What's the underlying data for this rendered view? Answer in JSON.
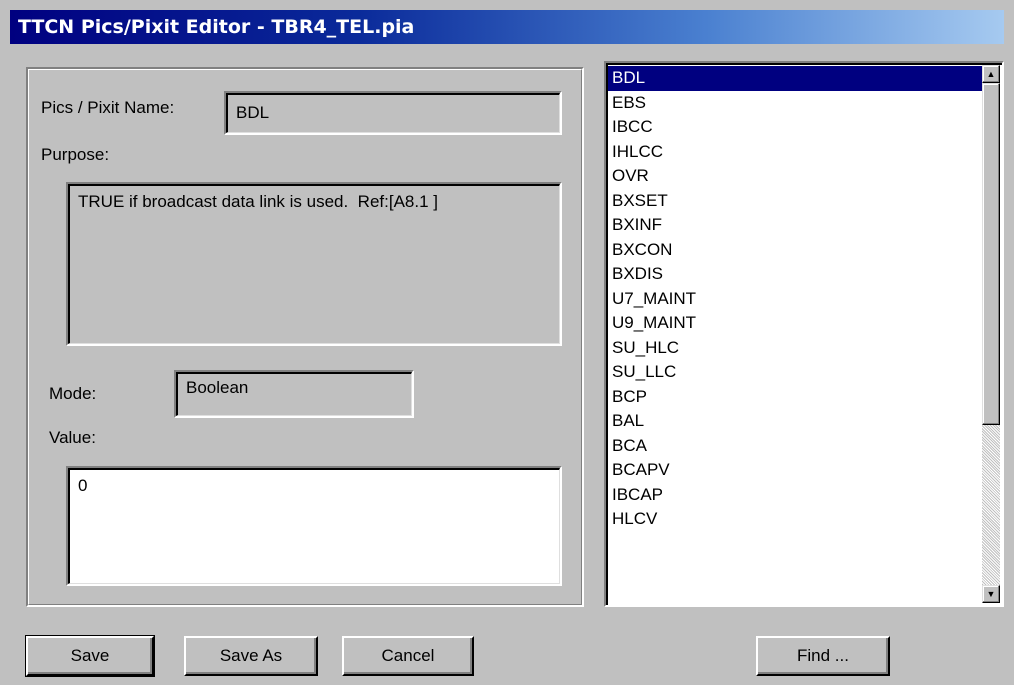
{
  "window": {
    "title": "TTCN Pics/Pixit Editor - TBR4_TEL.pia"
  },
  "form": {
    "name_label": "Pics / Pixit Name:",
    "name_value": "BDL",
    "purpose_label": "Purpose:",
    "purpose_value": "TRUE if broadcast data link is used.  Ref:[A8.1 ]",
    "mode_label": "Mode:",
    "mode_value": "Boolean",
    "value_label": "Value:",
    "value_value": "0"
  },
  "list": {
    "selected_index": 0,
    "items": [
      "BDL",
      "EBS",
      "IBCC",
      "IHLCC",
      "OVR",
      "BXSET",
      "BXINF",
      "BXCON",
      "BXDIS",
      "U7_MAINT",
      "U9_MAINT",
      "SU_HLC",
      "SU_LLC",
      "BCP",
      "BAL",
      "BCA",
      "BCAPV",
      "IBCAP",
      "HLCV"
    ]
  },
  "buttons": {
    "save": "Save",
    "save_as": "Save As",
    "cancel": "Cancel",
    "find": "Find ..."
  },
  "icons": {
    "scroll_up": "up-arrow-icon",
    "scroll_down": "down-arrow-icon"
  },
  "colors": {
    "title_start": "#000080",
    "title_end": "#a6caf0",
    "selection": "#000080",
    "face": "#c0c0c0"
  }
}
